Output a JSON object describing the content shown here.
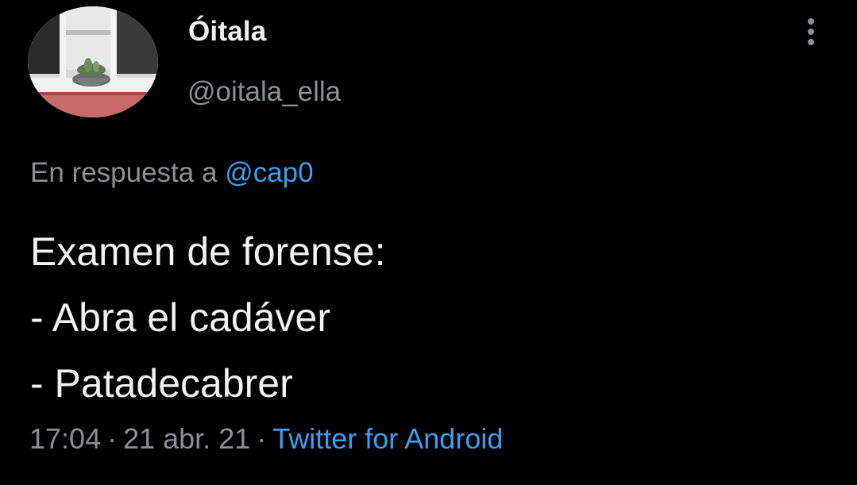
{
  "tweet": {
    "author": {
      "display_name": "Óitala",
      "handle": "@oitala_ella",
      "avatar_icon": "profile-photo-plant-pot"
    },
    "menu_icon": "more-vertical-icon",
    "reply_to": {
      "prefix": "En respuesta a",
      "mention": "@cap0"
    },
    "lines": [
      "Examen de forense:",
      "- Abra el cadáver",
      "- Patadecabrer"
    ],
    "time": "17:04",
    "separator": "·",
    "date": "21 abr. 21",
    "source": "Twitter for Android"
  },
  "colors": {
    "background": "#000000",
    "text": "#f2f2f2",
    "secondary": "#8b9096",
    "link": "#3d9ef0"
  }
}
